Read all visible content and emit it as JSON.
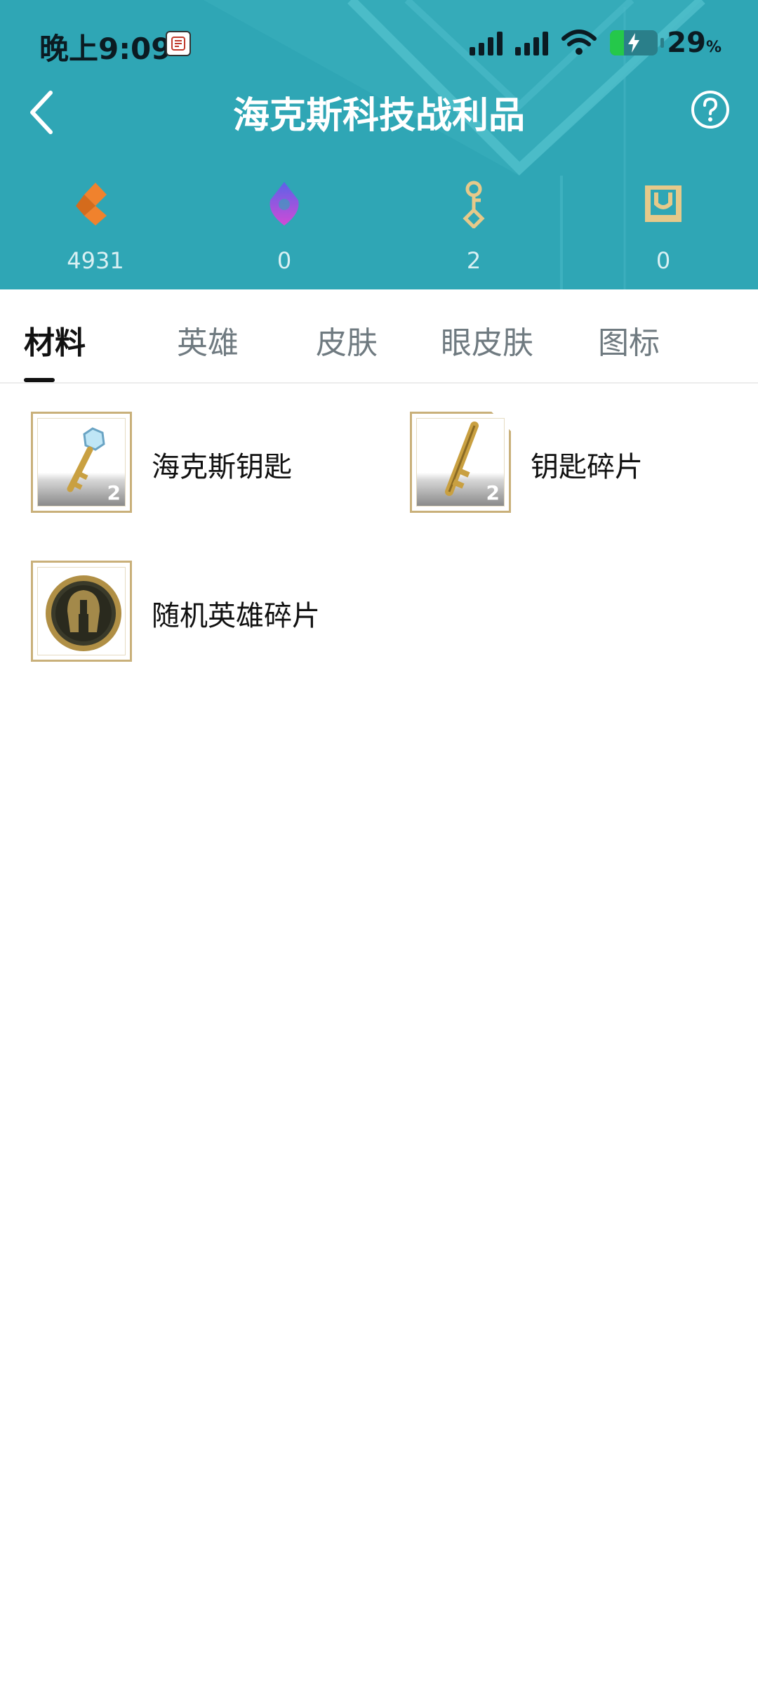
{
  "status_bar": {
    "time": "晚上9:09",
    "battery_percent": "29",
    "battery_unit": "%",
    "battery_level": 0.29
  },
  "header": {
    "title": "海克斯科技战利品"
  },
  "currencies": [
    {
      "icon": "orange-essence-icon",
      "value": "4931"
    },
    {
      "icon": "purple-gem-icon",
      "value": "0"
    },
    {
      "icon": "key-icon",
      "value": "2"
    },
    {
      "icon": "chest-icon",
      "value": "0"
    }
  ],
  "tabs": [
    {
      "label": "材料",
      "active": true
    },
    {
      "label": "英雄",
      "active": false
    },
    {
      "label": "皮肤",
      "active": false
    },
    {
      "label": "眼皮肤",
      "active": false
    },
    {
      "label": "图标",
      "active": false
    }
  ],
  "items": [
    {
      "name": "海克斯钥匙",
      "count": "2",
      "icon": "hextech-key-icon"
    },
    {
      "name": "钥匙碎片",
      "count": "2",
      "icon": "key-fragment-icon"
    },
    {
      "name": "随机英雄碎片",
      "count": "",
      "icon": "champion-shard-icon"
    }
  ],
  "colors": {
    "header_bg": "#2fa6b5",
    "frame_gold": "#c9b07a",
    "essence_orange": "#f0822d",
    "gem_purple": "#a146e0"
  }
}
